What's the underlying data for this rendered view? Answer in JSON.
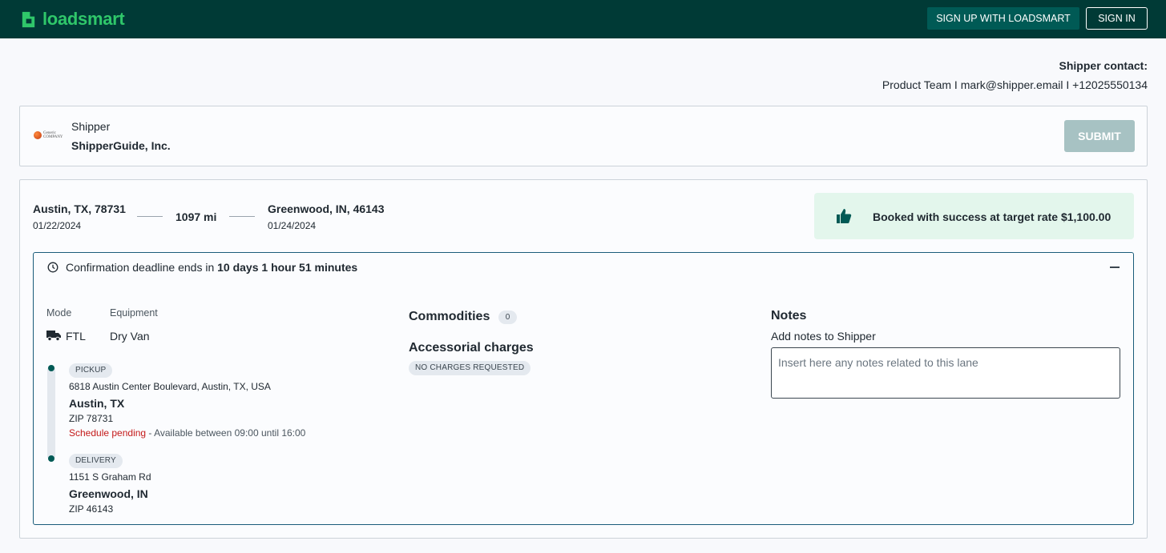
{
  "header": {
    "brand": "loadsmart",
    "signup_label": "SIGN UP WITH LOADSMART",
    "signin_label": "SIGN IN",
    "brand_color": "#2fc76a",
    "bg_color": "#003a36"
  },
  "contact": {
    "title": "Shipper contact:",
    "line": "Product Team I mark@shipper.email I +12025550134"
  },
  "shipper": {
    "label": "Shipper",
    "name": "ShipperGuide, Inc.",
    "logo_text_line1": "Generic",
    "logo_text_line2": "COMPANY",
    "submit_label": "SUBMIT"
  },
  "lane": {
    "origin_city": "Austin, TX, 78731",
    "origin_date": "01/22/2024",
    "distance": "1097 mi",
    "dest_city": "Greenwood, IN, 46143",
    "dest_date": "01/24/2024",
    "success_message": "Booked with success at target rate $1,100.00"
  },
  "details": {
    "deadline_prefix": "Confirmation deadline ends in ",
    "deadline_value": "10 days 1 hour 51 minutes",
    "mode_label": "Mode",
    "mode_value": "FTL",
    "equipment_label": "Equipment",
    "equipment_value": "Dry Van",
    "stops": [
      {
        "type": "PICKUP",
        "address": "6818 Austin Center Boulevard, Austin, TX, USA",
        "city": "Austin, TX",
        "zip": "ZIP 78731",
        "schedule_status": "Schedule pending",
        "availability": " - Available between 09:00 until 16:00"
      },
      {
        "type": "DELIVERY",
        "address": "1151 S Graham Rd",
        "city": "Greenwood, IN",
        "zip": "ZIP 46143"
      }
    ],
    "commodities_title": "Commodities",
    "commodities_count": "0",
    "accessorial_title": "Accessorial charges",
    "accessorial_tag": "NO CHARGES REQUESTED",
    "notes_title": "Notes",
    "notes_subtitle": "Add notes to Shipper",
    "notes_placeholder": "Insert here any notes related to this lane"
  }
}
